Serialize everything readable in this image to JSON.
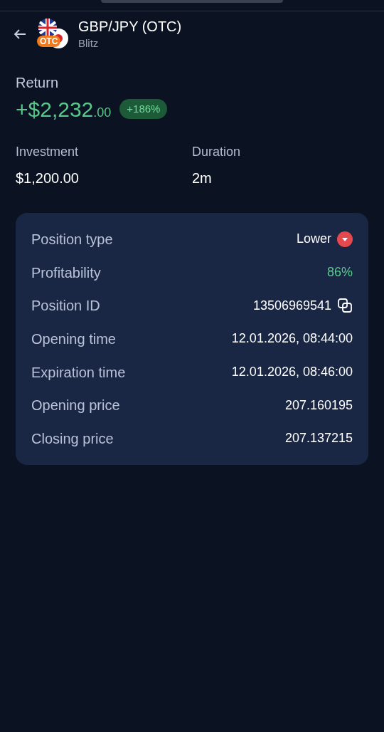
{
  "header": {
    "title": "GBP/JPY (OTC)",
    "subtitle": "Blitz",
    "badge": "OTC"
  },
  "return": {
    "label": "Return",
    "amount": "+$2,232",
    "cents": ".00",
    "percent": "+186%"
  },
  "stats": [
    {
      "label": "Investment",
      "value": "$1,200.00"
    },
    {
      "label": "Duration",
      "value": "2m"
    }
  ],
  "details": [
    {
      "label": "Position type",
      "value": "Lower",
      "kind": "direction"
    },
    {
      "label": "Profitability",
      "value": "86%",
      "kind": "positive"
    },
    {
      "label": "Position ID",
      "value": "13506969541",
      "kind": "copy"
    },
    {
      "label": "Opening time",
      "value": "12.01.2026, 08:44:00",
      "kind": "plain"
    },
    {
      "label": "Expiration time",
      "value": "12.01.2026, 08:46:00",
      "kind": "plain"
    },
    {
      "label": "Opening price",
      "value": "207.160195",
      "kind": "plain"
    },
    {
      "label": "Closing price",
      "value": "207.137215",
      "kind": "plain"
    }
  ]
}
